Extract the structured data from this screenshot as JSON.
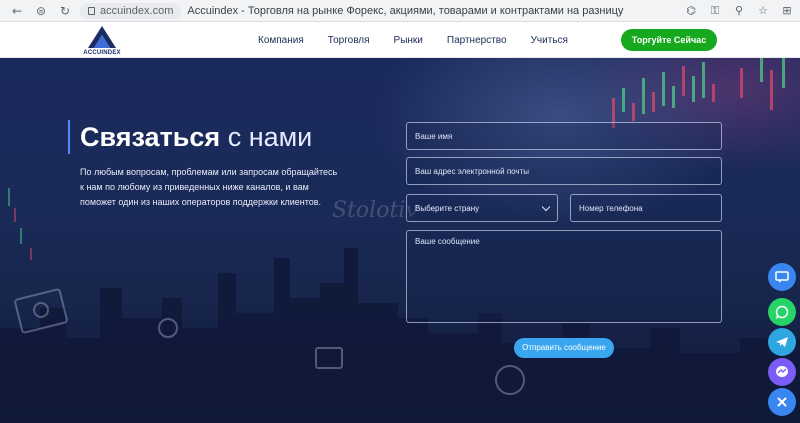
{
  "browser": {
    "url": "accuindex.com",
    "tab_title": "Accuindex - Торговля на рынке Форекс, акциями, товарами и контрактами на разницу цен с регулир..."
  },
  "header": {
    "logo_text": "ACCUINDEX",
    "nav": [
      "Компания",
      "Торговля",
      "Рынки",
      "Партнерство",
      "Учиться"
    ],
    "cta_label": "Торгуйте Сейчас"
  },
  "hero": {
    "title_bold": "Связаться",
    "title_rest": "с нами",
    "intro": "По любым вопросам, проблемам или запросам обращайтесь к нам по любому из приведенных ниже каналов, и вам поможет один из наших операторов поддержки клиентов."
  },
  "form": {
    "name_placeholder": "Ваше имя",
    "email_placeholder": "Ваш адрес электронной почты",
    "country_label": "Выберите страну",
    "phone_placeholder": "Номер телефона",
    "message_placeholder": "Ваше сообщение",
    "submit_label": "Отправить сообщение"
  },
  "watermark": "Stolotiv",
  "social": [
    {
      "icon": "chat-icon",
      "color": "#3a86f0"
    },
    {
      "icon": "whatsapp-icon",
      "color": "#25d366"
    },
    {
      "icon": "telegram-icon",
      "color": "#2ea6df"
    },
    {
      "icon": "messenger-icon",
      "color": "#7b5cf5"
    },
    {
      "icon": "close-icon",
      "color": "#3a86f0"
    }
  ],
  "colors": {
    "accent": "#16a81d",
    "button_blue": "#3aa6f0",
    "navy": "#1c2c64"
  }
}
